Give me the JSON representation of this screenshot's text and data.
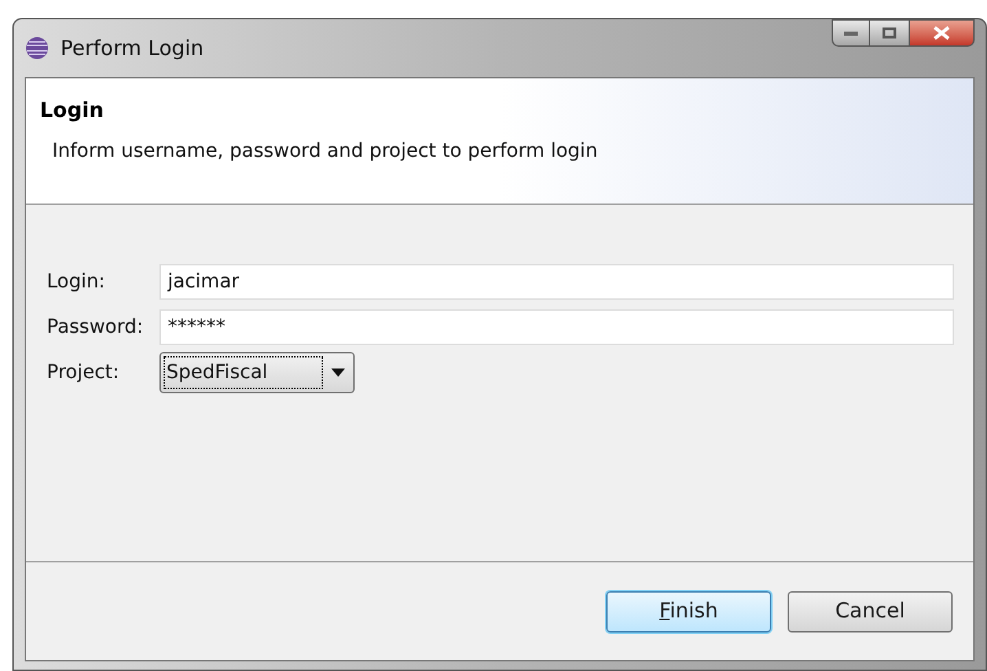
{
  "window": {
    "title": "Perform Login"
  },
  "header": {
    "title": "Login",
    "description": "Inform username, password and project to perform login"
  },
  "fields": [
    {
      "kind": "text",
      "label": "Login:",
      "value": "jacimar"
    },
    {
      "kind": "text",
      "label": "Password:",
      "value": "******"
    },
    {
      "kind": "select",
      "label": "Project:",
      "value": "SpedFiscal"
    }
  ],
  "buttons": [
    {
      "label": "Finish",
      "default": true,
      "mnemonic": true
    },
    {
      "label": "Cancel",
      "default": false,
      "mnemonic": false
    }
  ]
}
